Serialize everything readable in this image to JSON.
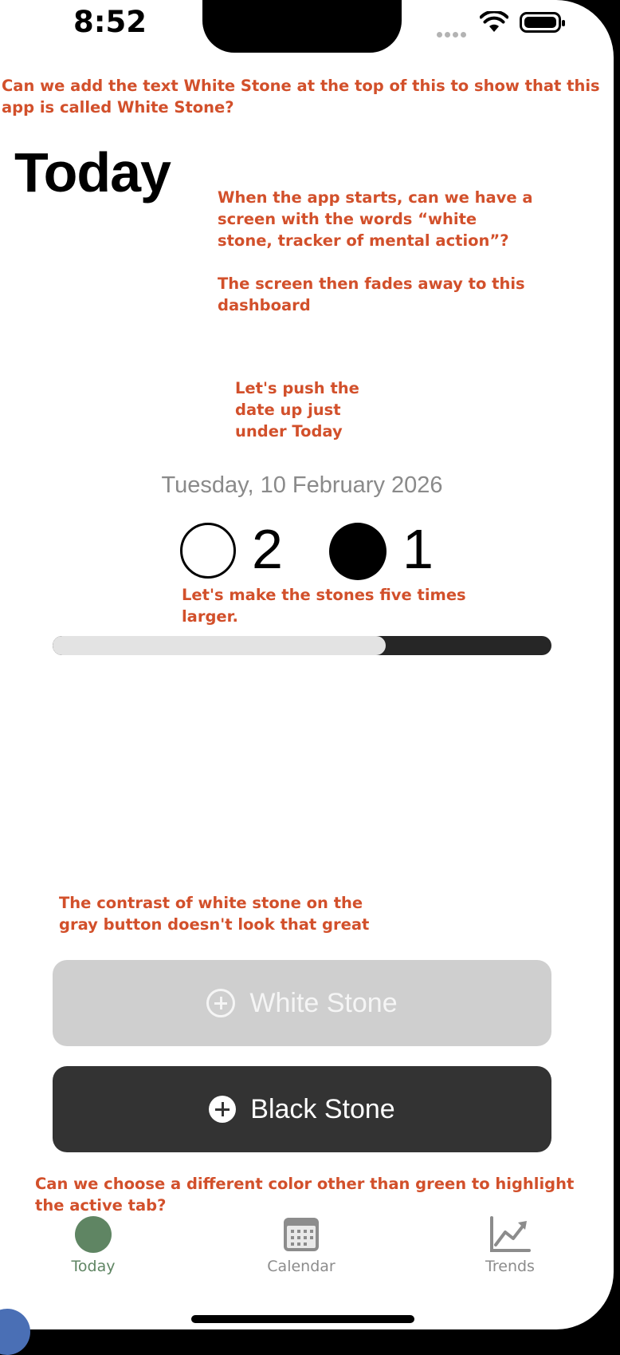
{
  "status_bar": {
    "time": "8:52"
  },
  "notes": {
    "top": "Can we add the text White Stone at the top of this to show that this app is called White Stone?",
    "splash": "When the app starts, can we have a screen with the words “white stone, tracker of mental action”?\n\nThe screen then fades away to this dashboard",
    "date": "Let's push the date up just under Today",
    "stones": "Let's make the stones five times larger.",
    "contrast": "The contrast of white stone on the gray button doesn't look that great",
    "tab_color": "Can we choose a different color other than green to highlight the active tab?"
  },
  "main": {
    "title": "Today",
    "date": "Tuesday, 10 February 2026",
    "white_count": "2",
    "black_count": "1",
    "white_fraction": 0.667
  },
  "buttons": {
    "white_label": "White Stone",
    "black_label": "Black Stone"
  },
  "tabs": [
    {
      "label": "Today",
      "icon": "filled-circle-icon",
      "active": true
    },
    {
      "label": "Calendar",
      "icon": "calendar-icon",
      "active": false
    },
    {
      "label": "Trends",
      "icon": "chart-line-icon",
      "active": false
    }
  ],
  "colors": {
    "accent": "#5f8563",
    "annotation": "#d2502b",
    "white_button": "#cfcfcf",
    "black_button": "#333333"
  }
}
